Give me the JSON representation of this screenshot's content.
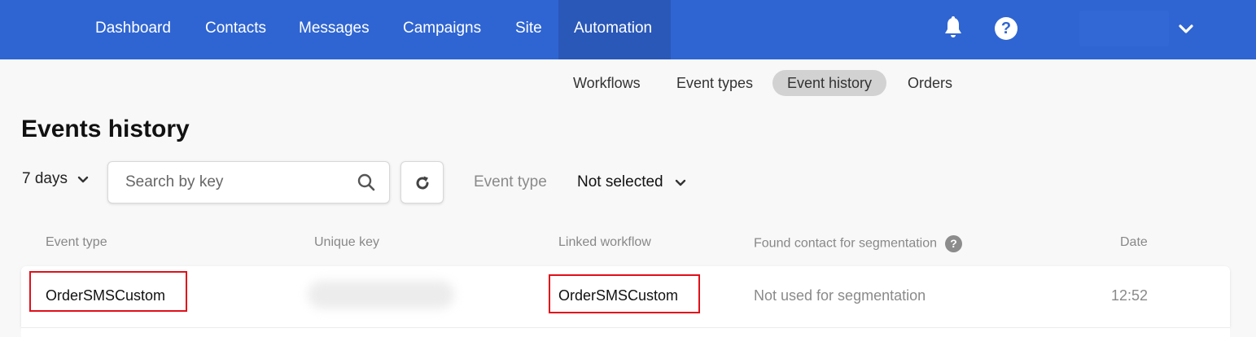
{
  "nav": {
    "items": [
      {
        "label": "Dashboard"
      },
      {
        "label": "Contacts"
      },
      {
        "label": "Messages"
      },
      {
        "label": "Campaigns"
      },
      {
        "label": "Site"
      },
      {
        "label": "Automation",
        "active": true
      }
    ],
    "icons": [
      "bell-icon",
      "help-icon",
      "chevron-down-icon"
    ],
    "help_glyph": "?"
  },
  "subtabs": [
    {
      "label": "Workflows"
    },
    {
      "label": "Event types"
    },
    {
      "label": "Event history",
      "active": true
    },
    {
      "label": "Orders"
    }
  ],
  "page": {
    "title": "Events history"
  },
  "filters": {
    "period": "7 days",
    "search_placeholder": "Search by key",
    "search_value": "",
    "event_type_label": "Event type",
    "event_type_value": "Not selected"
  },
  "table": {
    "columns": [
      "Event type",
      "Unique key",
      "Linked workflow",
      "Found contact for segmentation",
      "Date"
    ],
    "help_glyph": "?",
    "rows": [
      {
        "event_type": "OrderSMSCustom",
        "unique_key": "",
        "linked_workflow": "OrderSMSCustom",
        "found_contact": "Not used for segmentation",
        "date": "12:52"
      }
    ]
  },
  "colors": {
    "nav_bg": "#2f65d2",
    "nav_active_bg": "#2a58b8",
    "highlight": "#e0101a",
    "subtab_active_bg": "#d2d2d2"
  }
}
